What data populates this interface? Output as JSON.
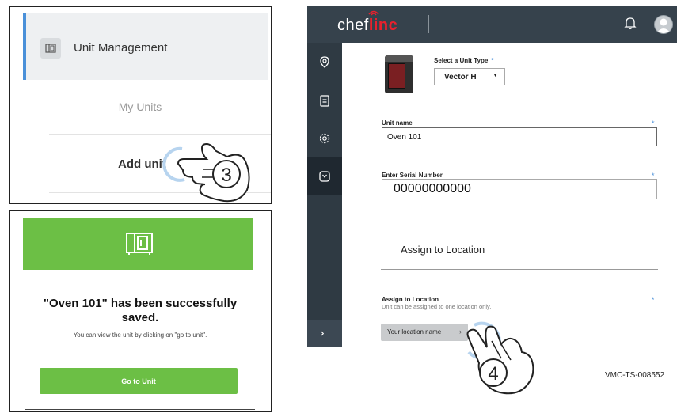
{
  "menu_panel": {
    "unit_management_label": "Unit Management",
    "my_units_label": "My Units",
    "add_unit_label": "Add unit",
    "accent_color": "#4a90d9"
  },
  "success_panel": {
    "message": "\"Oven 101\" has been successfully saved.",
    "sub_text": "You can view the unit by clicking on \"go to unit\".",
    "go_button_label": "Go to Unit",
    "brand_color": "#6cbf45"
  },
  "app": {
    "logo_light": "chef",
    "logo_bold": "linc",
    "form": {
      "unit_type_label": "Select a Unit Type",
      "unit_type_value": "Vector H",
      "unit_name_label": "Unit name",
      "unit_name_value": "Oven 101",
      "serial_label": "Enter Serial Number",
      "serial_value": "00000000000",
      "assign_title": "Assign to Location",
      "assign_label": "Assign to Location",
      "assign_hint": "Unit can be assigned to one location only.",
      "location_chip": "Your location name",
      "required_marker": "*"
    },
    "header_color": "#36424c",
    "logo_accent": "#e8212d"
  },
  "callouts": {
    "step_3": "3",
    "step_4": "4"
  },
  "reference": "VMC-TS-008552"
}
